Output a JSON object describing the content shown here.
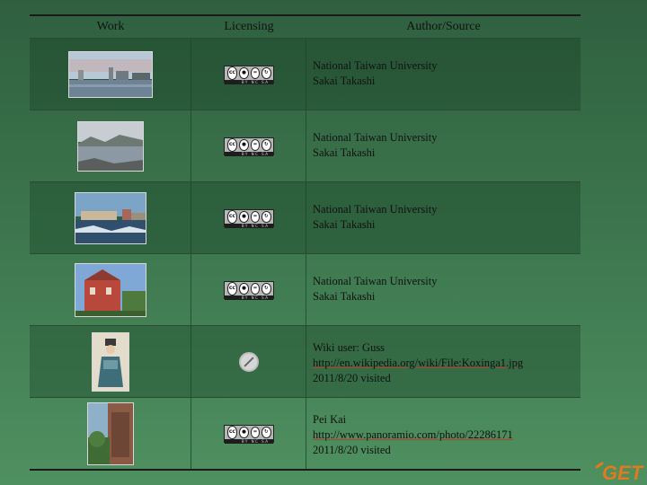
{
  "header": {
    "work": "Work",
    "licensing": "Licensing",
    "author_source": "Author/Source"
  },
  "rows": [
    {
      "license": "cc-by-nd-sa",
      "author_lines": [
        "National Taiwan University",
        "Sakai Takashi"
      ]
    },
    {
      "license": "cc-by-nd-sa",
      "author_lines": [
        "National Taiwan University",
        "Sakai Takashi"
      ]
    },
    {
      "license": "cc-by-nd-sa",
      "author_lines": [
        "National Taiwan University",
        "Sakai Takashi"
      ]
    },
    {
      "license": "cc-by-nd-sa",
      "author_lines": [
        "National Taiwan University",
        "Sakai Takashi"
      ]
    },
    {
      "license": "public-domain",
      "author_lines": [
        "Wiki user: Guss",
        "http://en.wikipedia.org/wiki/File:Koxinga1.jpg",
        "2011/8/20 visited"
      ]
    },
    {
      "license": "cc-by-nd-sa",
      "author_lines": [
        "Pei Kai",
        "http://www.panoramio.com/photo/22286171",
        "2011/8/20 visited"
      ]
    }
  ],
  "cc_badge": {
    "cc": "cc",
    "bar_text": "BY NC SA"
  },
  "logo_text": "GET"
}
